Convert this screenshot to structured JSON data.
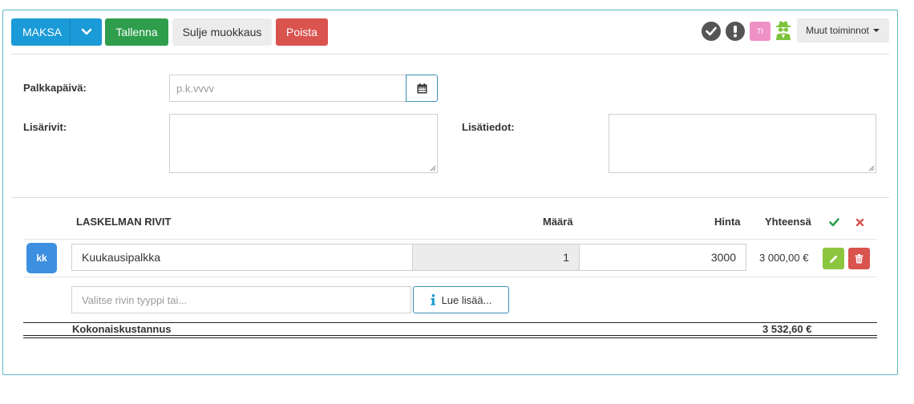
{
  "toolbar": {
    "pay_label": "MAKSA",
    "save_label": "Tallenna",
    "close_edit_label": "Sulje muokkaus",
    "delete_label": "Poista",
    "avatar_initials": "TI",
    "more_actions_label": "Muut toiminnot"
  },
  "form": {
    "payday_label": "Palkkapäivä:",
    "payday_placeholder": "p.k.vvvv",
    "extra_rows_label": "Lisärivit:",
    "extra_info_label": "Lisätiedot:"
  },
  "table": {
    "headers": {
      "rows": "LASKELMAN RIVIT",
      "quantity": "Määrä",
      "price": "Hinta",
      "total": "Yhteensä"
    },
    "rows": [
      {
        "badge": "kk",
        "name": "Kuukausipalkka",
        "quantity": "1",
        "price": "3000",
        "total": "3 000,00 €"
      }
    ],
    "new_row_placeholder": "Valitse rivin tyyppi tai...",
    "read_more_label": "Lue lisää...",
    "footer_label": "Kokonaiskustannus",
    "footer_total": "3 532,60 €"
  },
  "colors": {
    "primary": "#1a9ad6",
    "success": "#2e9e4c",
    "danger": "#d9534f",
    "edit": "#8cc63f",
    "badge": "#3d8fe0"
  }
}
